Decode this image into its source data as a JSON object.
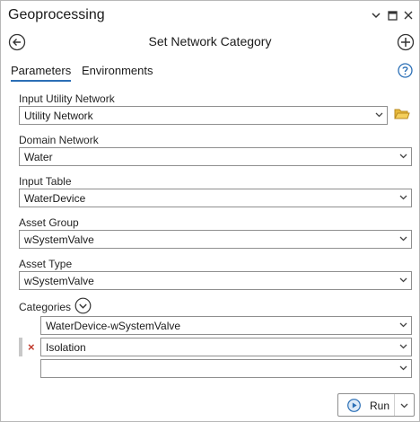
{
  "pane": {
    "title": "Geoprocessing"
  },
  "tool": {
    "title": "Set Network Category"
  },
  "tabs": [
    {
      "label": "Parameters",
      "active": true
    },
    {
      "label": "Environments",
      "active": false
    }
  ],
  "params": {
    "input_utility_network": {
      "label": "Input Utility Network",
      "value": "Utility Network"
    },
    "domain_network": {
      "label": "Domain Network",
      "value": "Water"
    },
    "input_table": {
      "label": "Input Table",
      "value": "WaterDevice"
    },
    "asset_group": {
      "label": "Asset Group",
      "value": "wSystemValve"
    },
    "asset_type": {
      "label": "Asset Type",
      "value": "wSystemValve"
    },
    "categories": {
      "label": "Categories",
      "header_value": "WaterDevice-wSystemValve",
      "items": [
        {
          "value": "Isolation"
        },
        {
          "value": ""
        }
      ]
    }
  },
  "run": {
    "label": "Run"
  },
  "colors": {
    "accent": "#2b6fb6",
    "remove": "#c0392b",
    "folder": "#e8b93a"
  }
}
